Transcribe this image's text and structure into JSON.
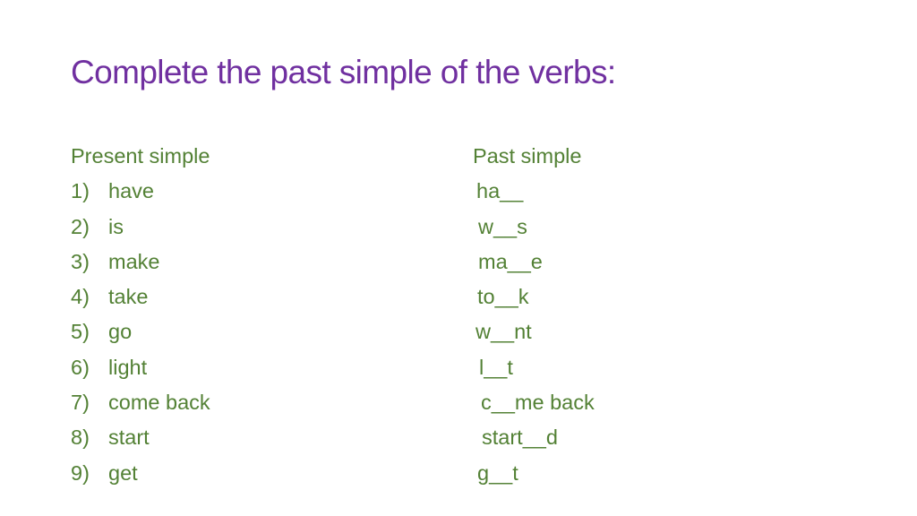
{
  "slide": {
    "title": "Complete the past simple of the verbs:",
    "colors": {
      "title": "#7030a0",
      "body": "#538135"
    },
    "present_header": "Present simple",
    "past_header": "Past simple",
    "items": [
      {
        "num": "1)",
        "present": "have",
        "past": "ha__"
      },
      {
        "num": "2)",
        "present": "is",
        "past": "w__s"
      },
      {
        "num": "3)",
        "present": "make",
        "past": "ma__e"
      },
      {
        "num": "4)",
        "present": "take",
        "past": "to__k"
      },
      {
        "num": "5)",
        "present": "go",
        "past": "w__nt"
      },
      {
        "num": "6)",
        "present": "light",
        "past": "l__t"
      },
      {
        "num": "7)",
        "present": "come back",
        "past": "c__me back"
      },
      {
        "num": "8)",
        "present": "start",
        "past": "start__d"
      },
      {
        "num": "9)",
        "present": "get",
        "past": "g__t"
      }
    ]
  }
}
